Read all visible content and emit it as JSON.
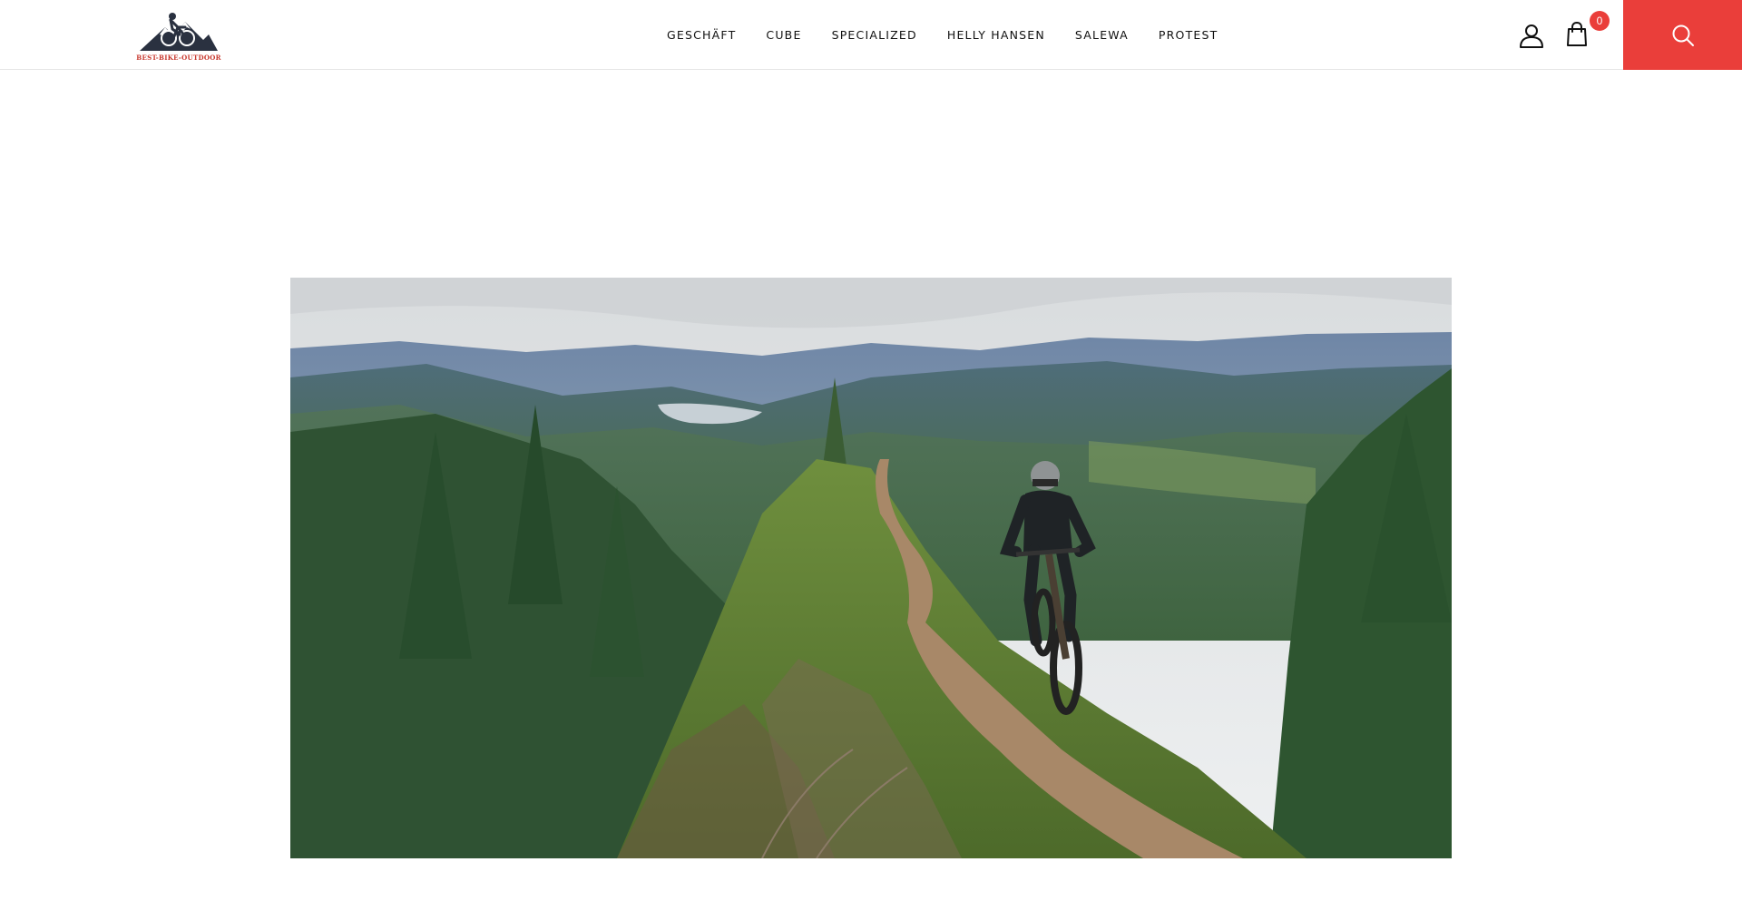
{
  "brand": {
    "logo_text": "BEST-BIKE-OUTDOOR",
    "logo_icon": "mountain-biker-logo",
    "accent_color": "#ea3e3a"
  },
  "nav": {
    "items": [
      {
        "label": "GESCHÄFT"
      },
      {
        "label": "CUBE"
      },
      {
        "label": "SPECIALIZED"
      },
      {
        "label": "HELLY HANSEN"
      },
      {
        "label": "SALEWA"
      },
      {
        "label": "PROTEST"
      }
    ]
  },
  "header_actions": {
    "account_icon": "user-icon",
    "cart_icon": "shopping-bag-icon",
    "cart_count": "0",
    "search_icon": "search-icon"
  },
  "hero": {
    "image_subject": "mountain-biker-on-ridge-trail"
  }
}
